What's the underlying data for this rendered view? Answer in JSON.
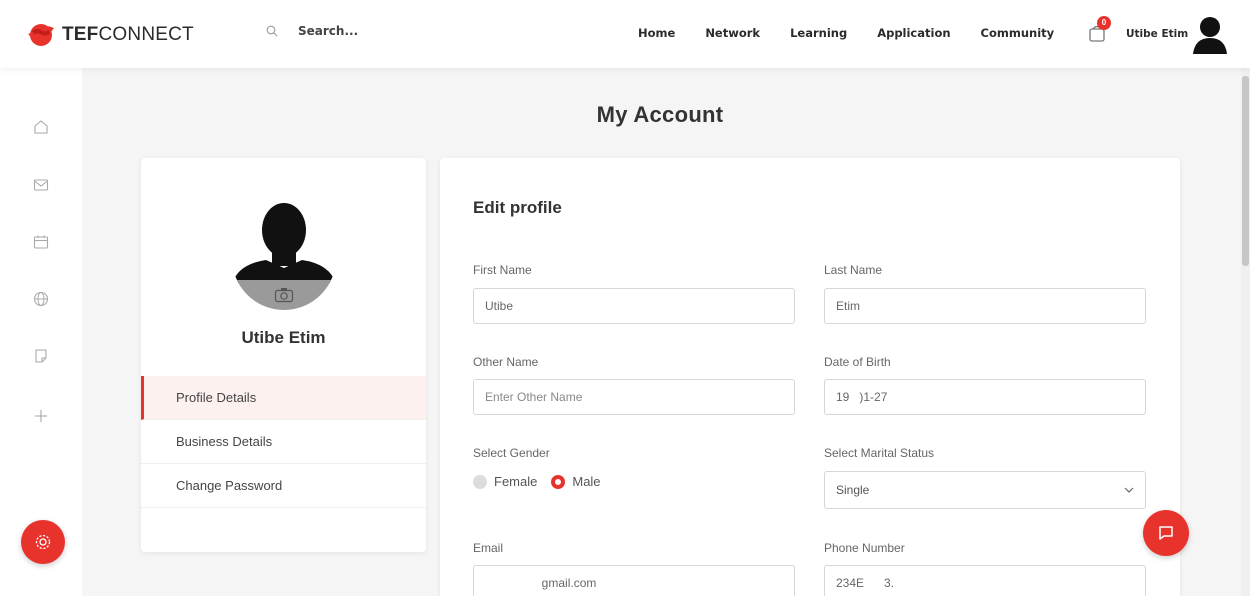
{
  "brand": {
    "bold": "TEF",
    "regular": "CONNECT"
  },
  "search": {
    "placeholder": "Search..."
  },
  "nav": [
    "Home",
    "Network",
    "Learning",
    "Application",
    "Community"
  ],
  "notifications": {
    "count": "0"
  },
  "user": {
    "name": "Utibe Etim"
  },
  "rail_icons": [
    "home-icon",
    "mail-icon",
    "calendar-icon",
    "globe-icon",
    "note-icon",
    "plus-icon"
  ],
  "page_title": "My Account",
  "profile": {
    "name": "Utibe Etim",
    "menu": [
      "Profile Details",
      "Business Details",
      "Change Password"
    ],
    "active_menu": "Profile Details"
  },
  "edit_profile": {
    "title": "Edit profile",
    "first_name": {
      "label": "First Name",
      "value": "Utibe"
    },
    "last_name": {
      "label": "Last Name",
      "value": "Etim"
    },
    "other_name": {
      "label": "Other Name",
      "placeholder": "Enter Other Name"
    },
    "dob": {
      "label": "Date of Birth",
      "value": "19   )1-27"
    },
    "gender": {
      "label": "Select Gender",
      "options": [
        "Female",
        "Male"
      ],
      "selected": "Male"
    },
    "marital": {
      "label": "Select Marital Status",
      "value": "Single"
    },
    "email": {
      "label": "Email",
      "value": "                 gmail.com"
    },
    "phone": {
      "label": "Phone Number",
      "value": "234E      3."
    }
  },
  "colors": {
    "accent": "#e8322c",
    "background": "#f5f5f6",
    "card": "#ffffff"
  }
}
